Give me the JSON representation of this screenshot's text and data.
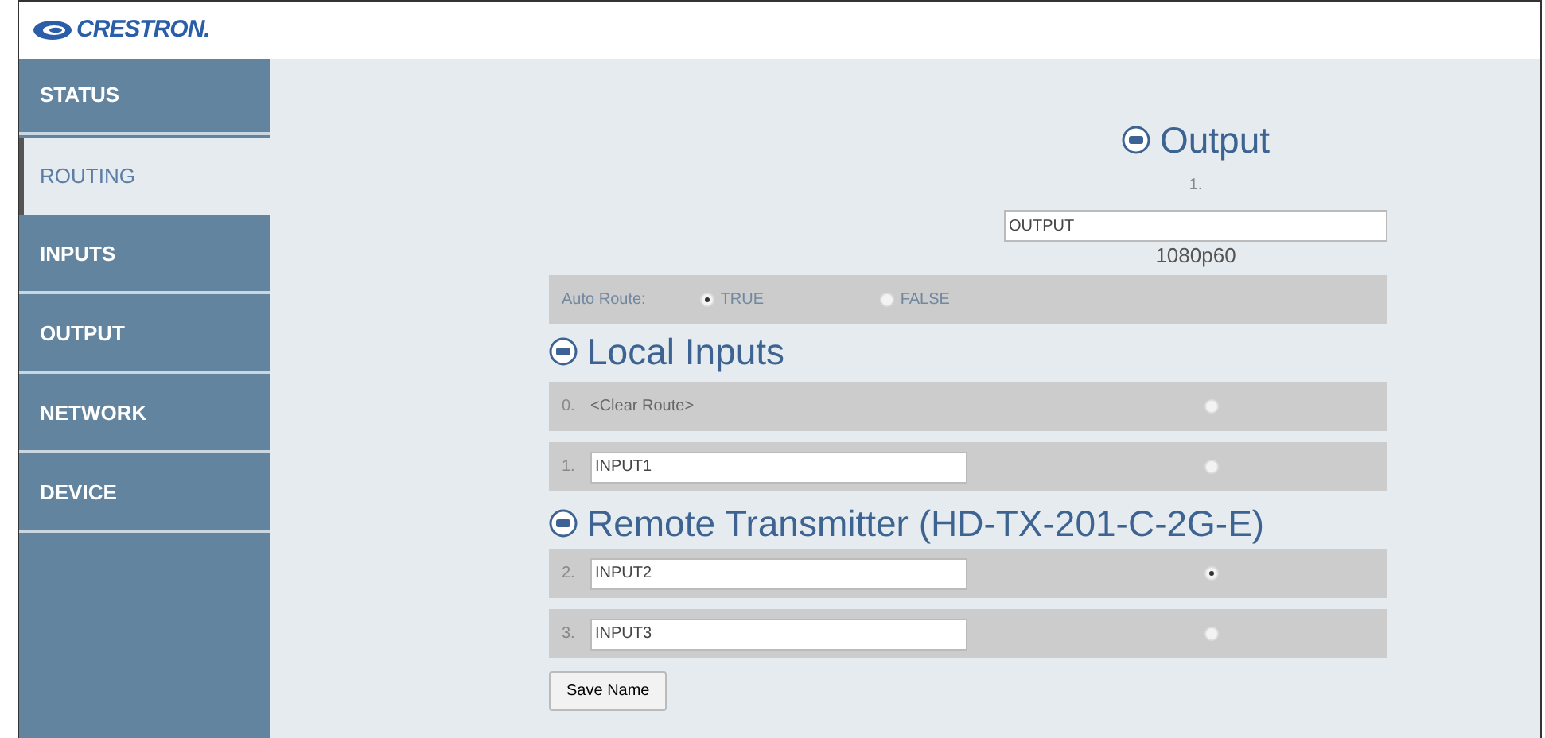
{
  "logo": {
    "text": "CRESTRON."
  },
  "sidebar": {
    "items": [
      {
        "label": "STATUS",
        "selected": false
      },
      {
        "label": "ROUTING",
        "selected": true
      },
      {
        "label": "INPUTS",
        "selected": false
      },
      {
        "label": "OUTPUT",
        "selected": false
      },
      {
        "label": "NETWORK",
        "selected": false
      },
      {
        "label": "DEVICE",
        "selected": false
      }
    ]
  },
  "output": {
    "title": "Output",
    "number": "1.",
    "name": "OUTPUT",
    "resolution": "1080p60"
  },
  "auto_route": {
    "label": "Auto Route:",
    "options": [
      {
        "label": "TRUE",
        "selected": true
      },
      {
        "label": "FALSE",
        "selected": false
      }
    ]
  },
  "sections": [
    {
      "title": "Local Inputs",
      "inputs": [
        {
          "number": "0.",
          "kind": "text",
          "label": "<Clear Route>",
          "selected": false
        },
        {
          "number": "1.",
          "kind": "field",
          "value": "INPUT1",
          "selected": false
        }
      ]
    },
    {
      "title": "Remote Transmitter (HD-TX-201-C-2G-E)",
      "inputs": [
        {
          "number": "2.",
          "kind": "field",
          "value": "INPUT2",
          "selected": true
        },
        {
          "number": "3.",
          "kind": "field",
          "value": "INPUT3",
          "selected": false
        }
      ]
    }
  ],
  "save_button": {
    "label": "Save Name"
  }
}
